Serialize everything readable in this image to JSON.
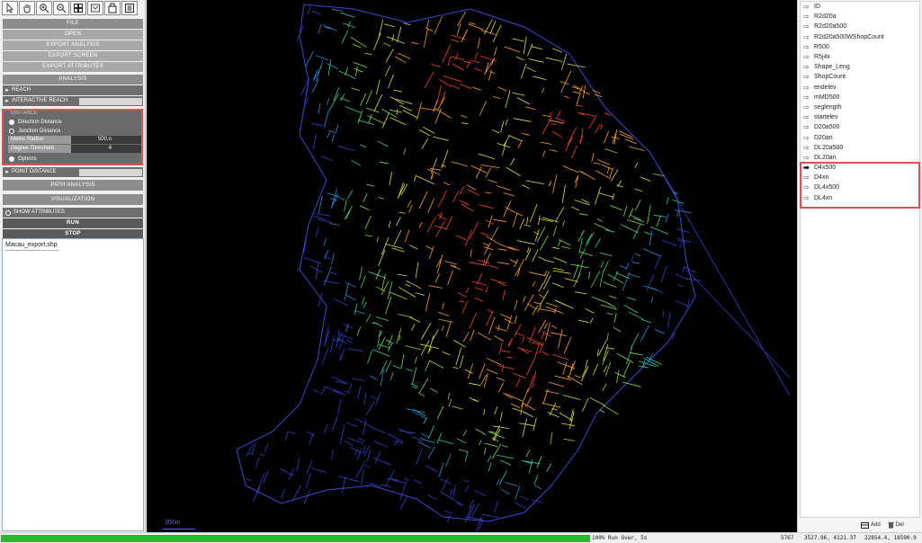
{
  "toolbar": {
    "icons": [
      "select-arrow-icon",
      "pan-hand-icon",
      "zoom-in-icon",
      "zoom-out-icon",
      "grid-icon",
      "fit-extent-icon",
      "export-icon",
      "list-icon"
    ]
  },
  "menu": {
    "file": "FILE",
    "open": "OPEN",
    "export_analysis": "EXPORT ANALYSIS",
    "export_screen": "EXPORT SCREEN",
    "export_attributes": "EXPORT ATTRIBUTES",
    "analysis": "ANALYSIS",
    "reach": "REACH",
    "interactive_reach": "INTERACTIVE REACH",
    "distance": "DISTANCE",
    "point_distance": "POINT DISTANCE",
    "path_analysis": "PATH ANALYSIS",
    "visualization": "VISUALIZATION",
    "show_attributes": "SHOW ATTRIBUTES",
    "run": "RUN",
    "stop": "STOP"
  },
  "distance_panel": {
    "direction_distance": "Direction Distance",
    "junction_distance": "Junction Distance",
    "metric_radius_label": "Metric Radius",
    "metric_radius_value": "500.n",
    "degree_threshold_label": "Degree Threshold",
    "degree_threshold_value": "4",
    "options": "Options"
  },
  "console": {
    "line1": "Macau_export.shp",
    "line2": "------------------------------------"
  },
  "map": {
    "scale_label": "356m"
  },
  "attributes": [
    "ID",
    "R2d20a",
    "R2d20a500",
    "R2d20a500WShopCount",
    "R500",
    "R5j4x",
    "Shape_Leng",
    "ShopCount",
    "endelev",
    "mMD500",
    "seglength",
    "startelev",
    "D20a500",
    "D20an",
    "DL20a500",
    "DL20an",
    "D4x500",
    "D4xn",
    "DL4x500",
    "DL4xn"
  ],
  "selected_attribute": "D4x500",
  "right_actions": {
    "add": "Add",
    "del": "Del"
  },
  "status": {
    "progress_percent": 100,
    "text": "100% Run Over, 5s",
    "r1": "5767",
    "r2": "3527.96, 4121.37",
    "r3": "22854.4, 18590.9"
  },
  "colors": {
    "highlight_box": "#e05050",
    "progress": "#2fb52f",
    "map_background": "#000000"
  }
}
